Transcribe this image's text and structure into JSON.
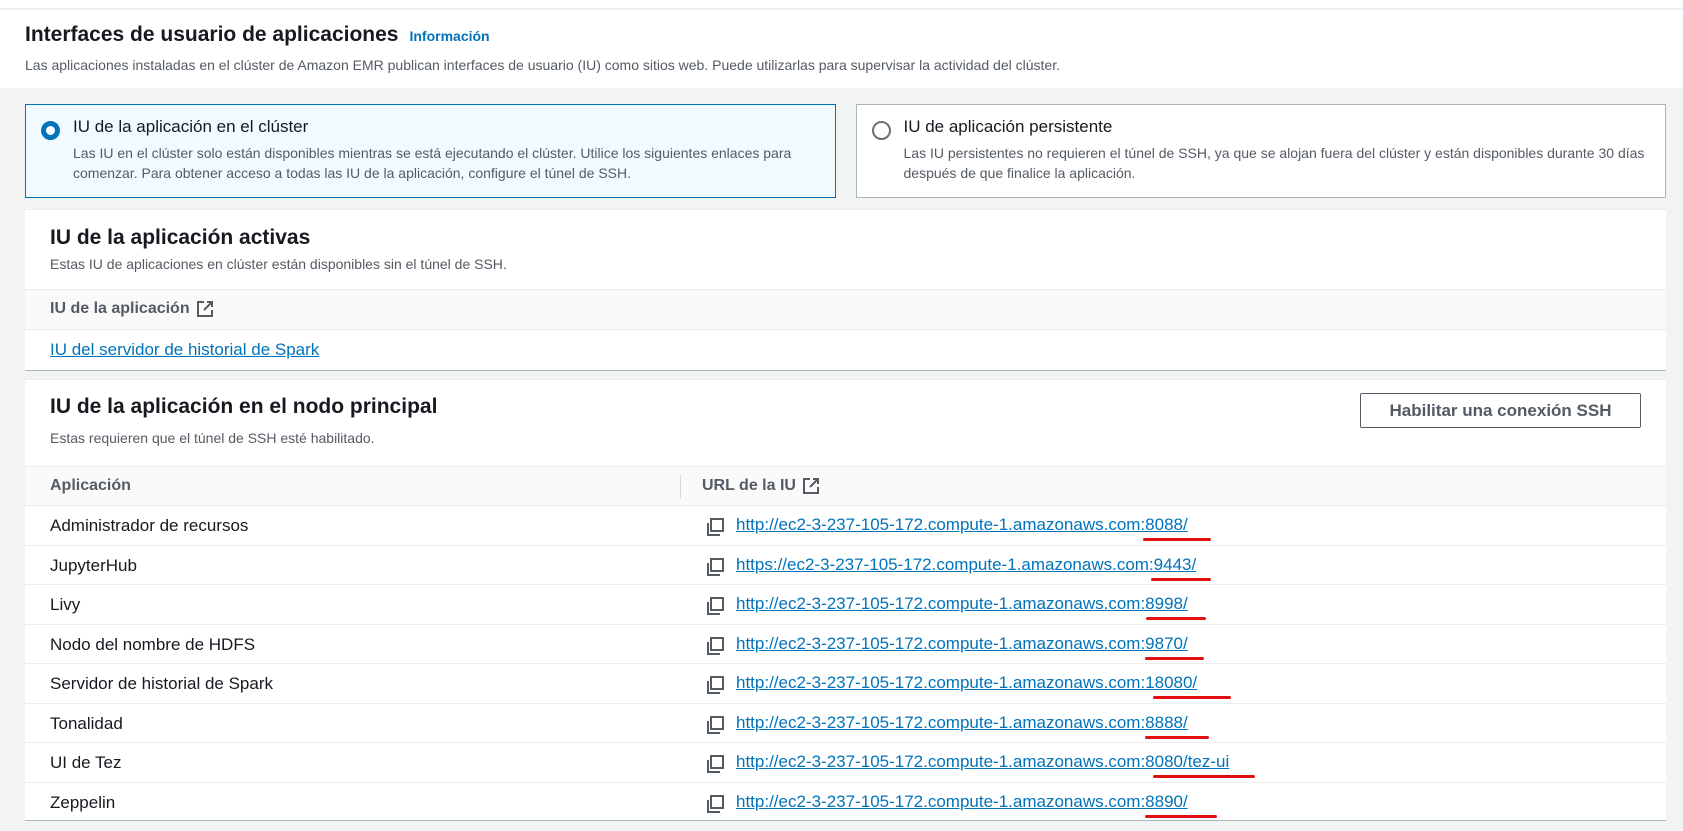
{
  "header": {
    "title": "Interfaces de usuario de aplicaciones",
    "info_label": "Información",
    "description": "Las aplicaciones instaladas en el clúster de Amazon EMR publican interfaces de usuario (IU) como sitios web. Puede utilizarlas para supervisar la actividad del clúster."
  },
  "tiles": [
    {
      "title": "IU de la aplicación en el clúster",
      "description": "Las IU en el clúster solo están disponibles mientras se está ejecutando el clúster. Utilice los siguientes enlaces para comenzar. Para obtener acceso a todas las IU de la aplicación, configure el túnel de SSH.",
      "selected": true
    },
    {
      "title": "IU de aplicación persistente",
      "description": "Las IU persistentes no requieren el túnel de SSH, ya que se alojan fuera del clúster y están disponibles durante 30 días después de que finalice la aplicación.",
      "selected": false
    }
  ],
  "active_panel": {
    "heading": "IU de la aplicación activas",
    "description": "Estas IU de aplicaciones en clúster están disponibles sin el túnel de SSH.",
    "column_header": "IU de la aplicación",
    "link": "IU del servidor de historial de Spark"
  },
  "primary_panel": {
    "heading": "IU de la aplicación en el nodo principal",
    "description": "Estas requieren que el túnel de SSH esté habilitado.",
    "ssh_button": "Habilitar una conexión SSH",
    "columns": {
      "application": "Aplicación",
      "url": "URL de la IU"
    },
    "rows": [
      {
        "app": "Administrador de recursos",
        "url": "http://ec2-3-237-105-172.compute-1.amazonaws.com:8088/"
      },
      {
        "app": "JupyterHub",
        "url": "https://ec2-3-237-105-172.compute-1.amazonaws.com:9443/"
      },
      {
        "app": "Livy",
        "url": "http://ec2-3-237-105-172.compute-1.amazonaws.com:8998/"
      },
      {
        "app": "Nodo del nombre de HDFS",
        "url": "http://ec2-3-237-105-172.compute-1.amazonaws.com:9870/"
      },
      {
        "app": "Servidor de historial de Spark",
        "url": "http://ec2-3-237-105-172.compute-1.amazonaws.com:18080/"
      },
      {
        "app": "Tonalidad",
        "url": "http://ec2-3-237-105-172.compute-1.amazonaws.com:8888/"
      },
      {
        "app": "UI de Tez",
        "url": "http://ec2-3-237-105-172.compute-1.amazonaws.com:8080/tez-ui"
      },
      {
        "app": "Zeppelin",
        "url": "http://ec2-3-237-105-172.compute-1.amazonaws.com:8890/"
      }
    ]
  },
  "colors": {
    "link": "#0073bb",
    "annotation": "#e01010",
    "selected_tile_bg": "#f1faff"
  },
  "icons": [
    "external-link-icon",
    "copy-icon"
  ]
}
